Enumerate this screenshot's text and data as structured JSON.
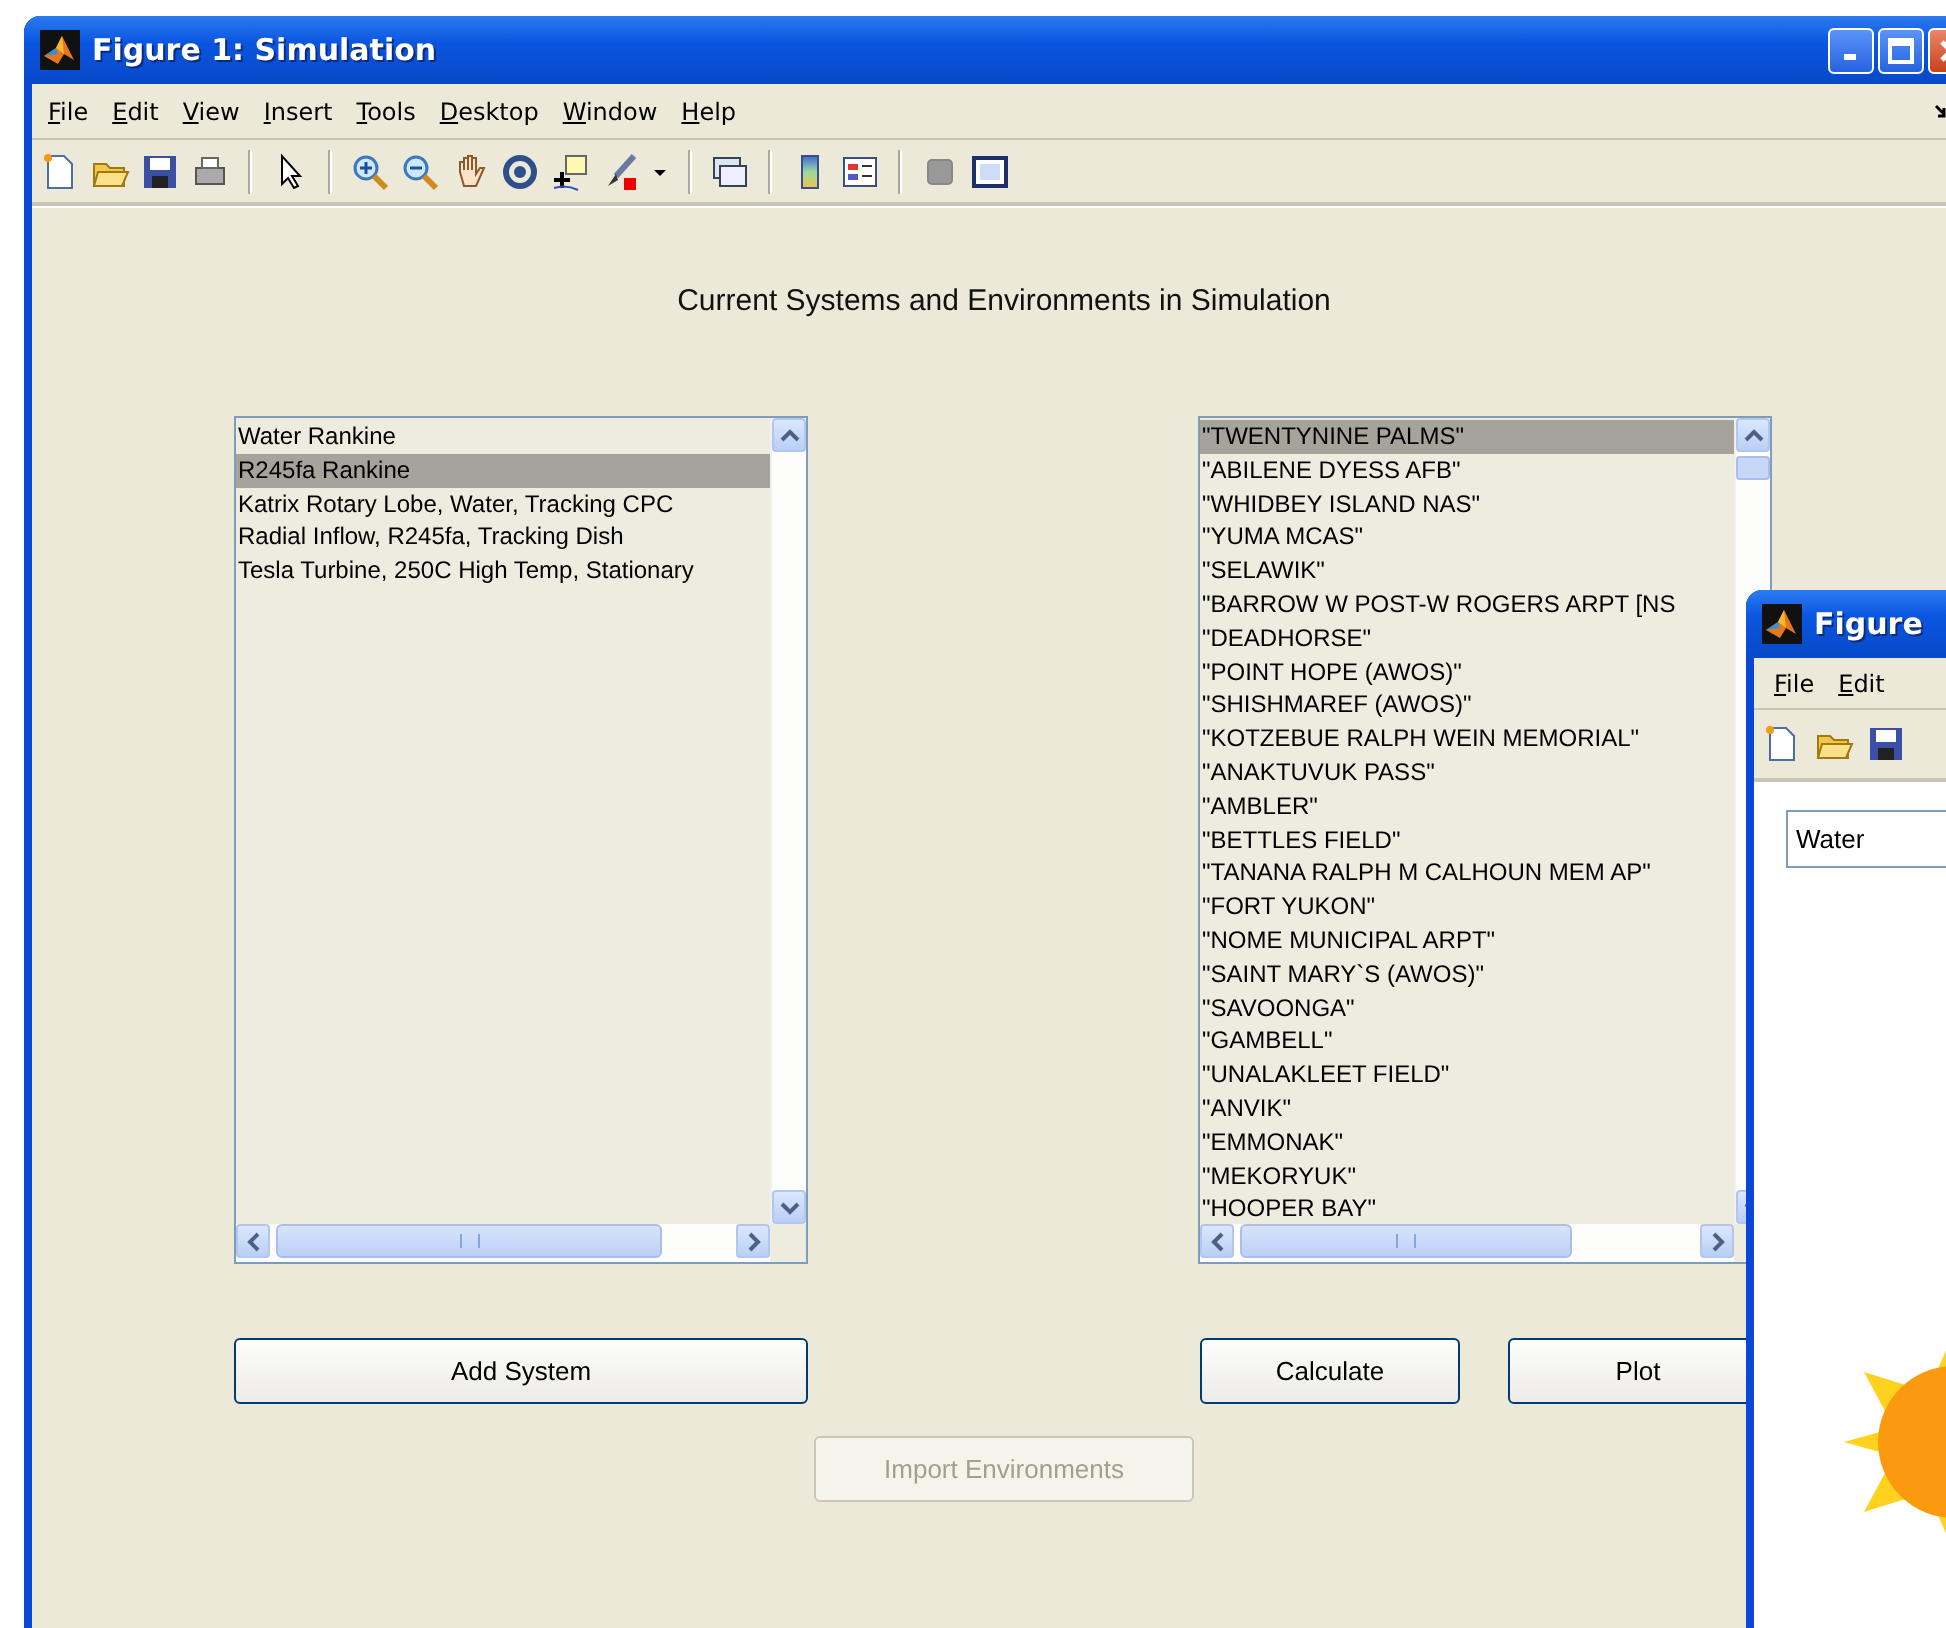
{
  "window": {
    "title": "Figure 1: Simulation"
  },
  "menu": [
    {
      "label": "File"
    },
    {
      "label": "Edit"
    },
    {
      "label": "View"
    },
    {
      "label": "Insert"
    },
    {
      "label": "Tools"
    },
    {
      "label": "Desktop"
    },
    {
      "label": "Window"
    },
    {
      "label": "Help"
    }
  ],
  "heading": "Current Systems and Environments in Simulation",
  "systems_list": {
    "items": [
      {
        "label": "Water Rankine",
        "selected": false
      },
      {
        "label": "R245fa Rankine",
        "selected": true
      },
      {
        "label": "Katrix Rotary Lobe, Water, Tracking CPC",
        "selected": false
      },
      {
        "label": "Radial Inflow, R245fa, Tracking Dish",
        "selected": false
      },
      {
        "label": "Tesla Turbine, 250C High Temp, Stationary",
        "selected": false
      }
    ]
  },
  "environments_list": {
    "items": [
      {
        "label": "\"TWENTYNINE PALMS\"",
        "selected": true
      },
      {
        "label": "\"ABILENE DYESS AFB\"",
        "selected": false
      },
      {
        "label": "\"WHIDBEY ISLAND NAS\"",
        "selected": false
      },
      {
        "label": "\"YUMA MCAS\"",
        "selected": false
      },
      {
        "label": "\"SELAWIK\"",
        "selected": false
      },
      {
        "label": "\"BARROW W POST-W ROGERS ARPT [NS",
        "selected": false
      },
      {
        "label": "\"DEADHORSE\"",
        "selected": false
      },
      {
        "label": "\"POINT HOPE (AWOS)\"",
        "selected": false
      },
      {
        "label": "\"SHISHMAREF (AWOS)\"",
        "selected": false
      },
      {
        "label": "\"KOTZEBUE RALPH WEIN MEMORIAL\"",
        "selected": false
      },
      {
        "label": "\"ANAKTUVUK PASS\"",
        "selected": false
      },
      {
        "label": "\"AMBLER\"",
        "selected": false
      },
      {
        "label": "\"BETTLES FIELD\"",
        "selected": false
      },
      {
        "label": "\"TANANA RALPH M CALHOUN MEM AP\"",
        "selected": false
      },
      {
        "label": "\"FORT YUKON\"",
        "selected": false
      },
      {
        "label": "\"NOME MUNICIPAL ARPT\"",
        "selected": false
      },
      {
        "label": "\"SAINT MARY`S (AWOS)\"",
        "selected": false
      },
      {
        "label": "\"SAVOONGA\"",
        "selected": false
      },
      {
        "label": "\"GAMBELL\"",
        "selected": false
      },
      {
        "label": "\"UNALAKLEET FIELD\"",
        "selected": false
      },
      {
        "label": "\"ANVIK\"",
        "selected": false
      },
      {
        "label": "\"EMMONAK\"",
        "selected": false
      },
      {
        "label": "\"MEKORYUK\"",
        "selected": false
      },
      {
        "label": "\"HOOPER BAY\"",
        "selected": false
      }
    ]
  },
  "add_system_button": {
    "label": "Add System",
    "disabled": false
  },
  "calculate_button": {
    "label": "Calculate",
    "disabled": false
  },
  "plot_button": {
    "label": "Plot",
    "disabled": false
  },
  "import_button": {
    "label": "Import Environments",
    "disabled": true
  },
  "second_window": {
    "title": "Figure",
    "menu": [
      {
        "label": "File"
      },
      {
        "label": "Edit"
      }
    ],
    "field": {
      "value": "Water"
    }
  }
}
